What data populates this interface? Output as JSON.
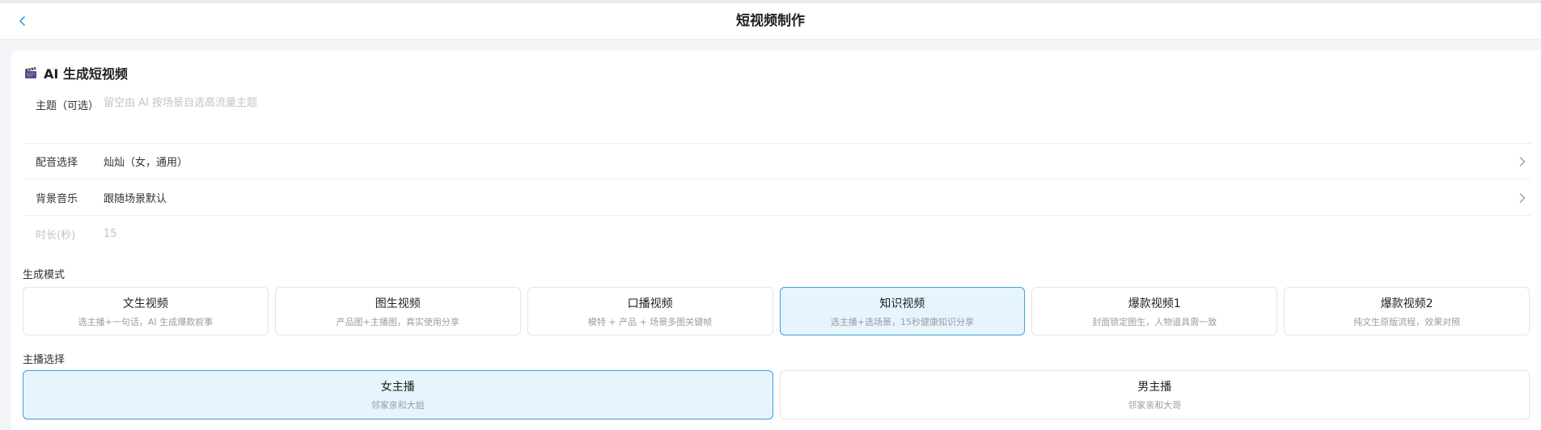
{
  "nav": {
    "title": "短视频制作"
  },
  "card": {
    "title": "AI 生成短视频"
  },
  "form": {
    "topic": {
      "label": "主题（可选）",
      "placeholder": "留空由 AI 按场景自选高流量主题",
      "value": ""
    },
    "voice": {
      "label": "配音选择",
      "value": "灿灿（女，通用）"
    },
    "music": {
      "label": "背景音乐",
      "value": "跟随场景默认"
    },
    "duration": {
      "label": "时长(秒)",
      "value": "15"
    }
  },
  "modes": {
    "label": "生成模式",
    "items": [
      {
        "name": "文生视频",
        "desc": "选主播+一句话，AI 生成爆款叙事",
        "active": false
      },
      {
        "name": "图生视频",
        "desc": "产品图+主播图，真实使用分享",
        "active": false
      },
      {
        "name": "口播视频",
        "desc": "模特 + 产品 + 场景多图关键帧",
        "active": false
      },
      {
        "name": "知识视频",
        "desc": "选主播+选场景，15秒健康知识分享",
        "active": true
      },
      {
        "name": "爆款视频1",
        "desc": "封面锁定图生，人物道具需一致",
        "active": false
      },
      {
        "name": "爆款视频2",
        "desc": "纯文生原版流程，效果对照",
        "active": false
      }
    ]
  },
  "anchors": {
    "label": "主播选择",
    "items": [
      {
        "name": "女主播",
        "desc": "邻家亲和大姐",
        "active": true
      },
      {
        "name": "男主播",
        "desc": "邻家亲和大哥",
        "active": false
      }
    ]
  },
  "colors": {
    "accent": "#3a9fe0",
    "active_bg": "#e6f5fd",
    "page_bg": "#f4f5f8"
  },
  "icons": {
    "back": "chevron-left-icon",
    "card": "clapperboard-icon",
    "row_arrow": "chevron-right-icon"
  }
}
